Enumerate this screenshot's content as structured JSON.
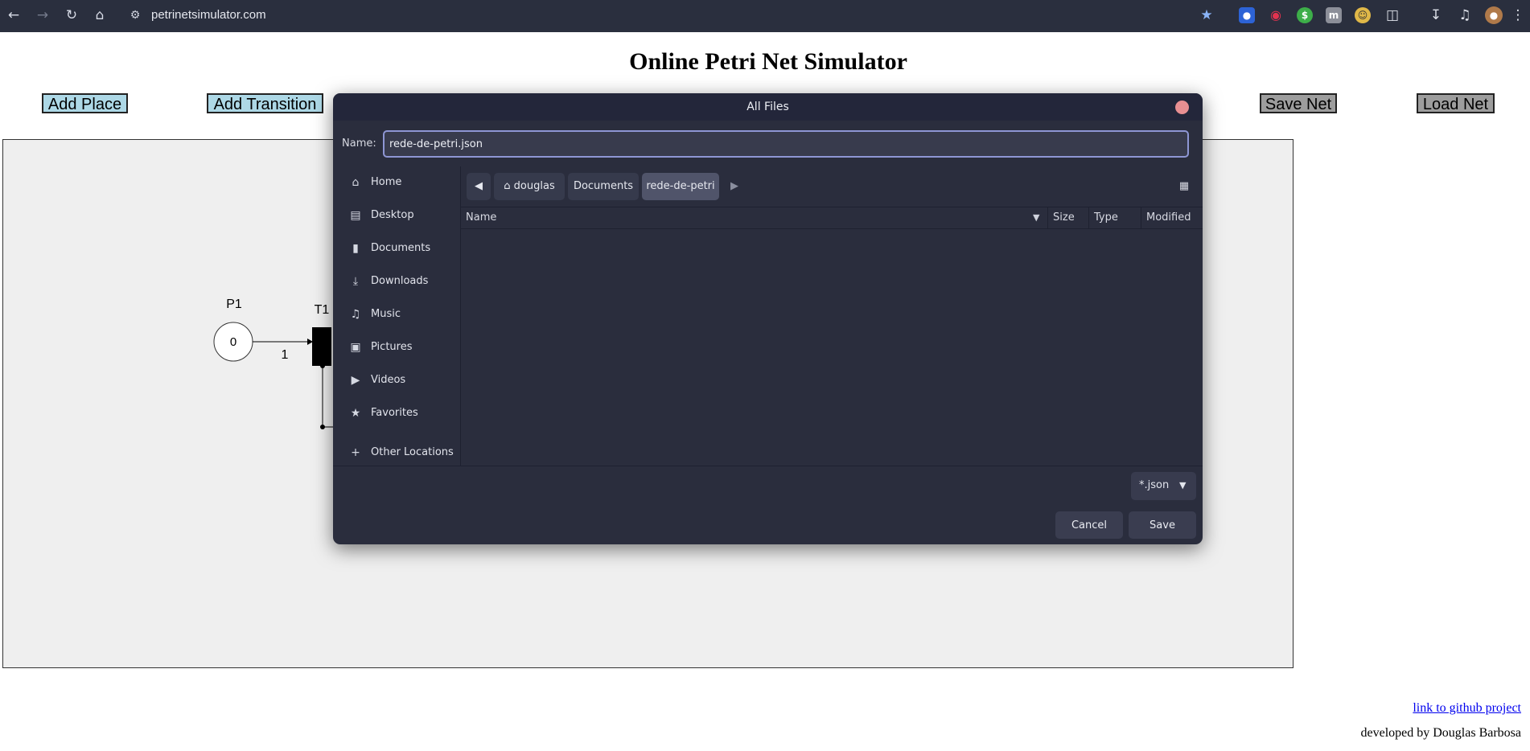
{
  "browser": {
    "url": "petrinetsimulator.com",
    "extension_icons": [
      "shield-extension-icon",
      "record-extension-icon",
      "dollar-extension-icon",
      "m-extension-icon",
      "smiley-extension-icon",
      "puzzle-extensions-icon"
    ],
    "toolbar_icons": [
      "download-icon",
      "media-playlist-icon",
      "profile-avatar",
      "kebab-menu-icon"
    ]
  },
  "page": {
    "title": "Online Petri Net Simulator",
    "buttons": {
      "add_place": "Add Place",
      "add_transition": "Add Transition",
      "save_net": "Save Net",
      "load_net": "Load Net"
    },
    "net": {
      "place_label": "P1",
      "place_tokens": "0",
      "transition_label": "T1",
      "arc_weight": "1"
    },
    "footer": {
      "github_link": "link to github project",
      "developer": "developed by Douglas Barbosa"
    }
  },
  "dialog": {
    "title": "All Files",
    "name_label": "Name:",
    "filename": "rede-de-petri.json",
    "sidebar": [
      {
        "label": "Home",
        "icon": "home-icon"
      },
      {
        "label": "Desktop",
        "icon": "desktop-icon"
      },
      {
        "label": "Documents",
        "icon": "document-icon"
      },
      {
        "label": "Downloads",
        "icon": "download-icon"
      },
      {
        "label": "Music",
        "icon": "music-icon"
      },
      {
        "label": "Pictures",
        "icon": "picture-icon"
      },
      {
        "label": "Videos",
        "icon": "video-icon"
      },
      {
        "label": "Favorites",
        "icon": "star-icon"
      },
      {
        "label": "Other Locations",
        "icon": "plus-icon"
      }
    ],
    "path": [
      "douglas",
      "Documents",
      "rede-de-petri"
    ],
    "columns": {
      "name": "Name",
      "size": "Size",
      "type": "Type",
      "modified": "Modified"
    },
    "filter": "*.json",
    "cancel": "Cancel",
    "save": "Save"
  },
  "colors": {
    "button_blue": "#add8e6",
    "button_gray": "#9d9d9d",
    "dialog_bg": "#2a2d3d",
    "toolbar_bg": "#2a2f3e",
    "link": "#0000ee"
  }
}
